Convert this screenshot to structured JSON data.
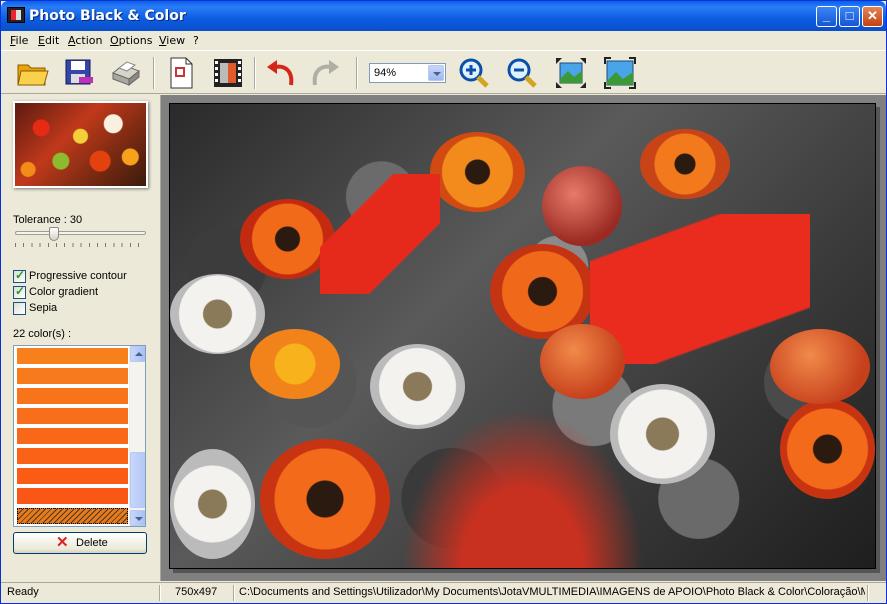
{
  "window": {
    "title": "Photo Black & Color"
  },
  "menu": [
    "File",
    "Edit",
    "Action",
    "Options",
    "View",
    "?"
  ],
  "toolbar": {
    "zoom_value": "94%",
    "icons": [
      "open-folder-icon",
      "save-disk-icon",
      "print-icon",
      "new-document-icon",
      "film-icon",
      "undo-icon",
      "redo-icon",
      "zoom-in-icon",
      "zoom-out-icon",
      "fit-window-icon",
      "actual-size-icon"
    ]
  },
  "panel": {
    "tolerance_label": "Tolerance : 30",
    "tolerance_value": 30,
    "checks": [
      {
        "label": "Progressive contour",
        "checked": true
      },
      {
        "label": "Color gradient",
        "checked": true
      },
      {
        "label": "Sepia",
        "checked": false
      }
    ],
    "colors_label": "22 color(s) :",
    "swatches": [
      "#f7801d",
      "#f77b1c",
      "#f8741b",
      "#f86e1a",
      "#f96819",
      "#f96217",
      "#fa5c16",
      "#fa5615",
      "#e87a1c"
    ],
    "delete_label": "Delete"
  },
  "status": {
    "state": "Ready",
    "dimensions": "750x497",
    "path": "C:\\Documents and Settings\\Utilizador\\My Documents\\JotaVMULTIMEDIA\\IMAGENS de APOIO\\Photo Black & Color\\Coloração\\Mesa"
  }
}
